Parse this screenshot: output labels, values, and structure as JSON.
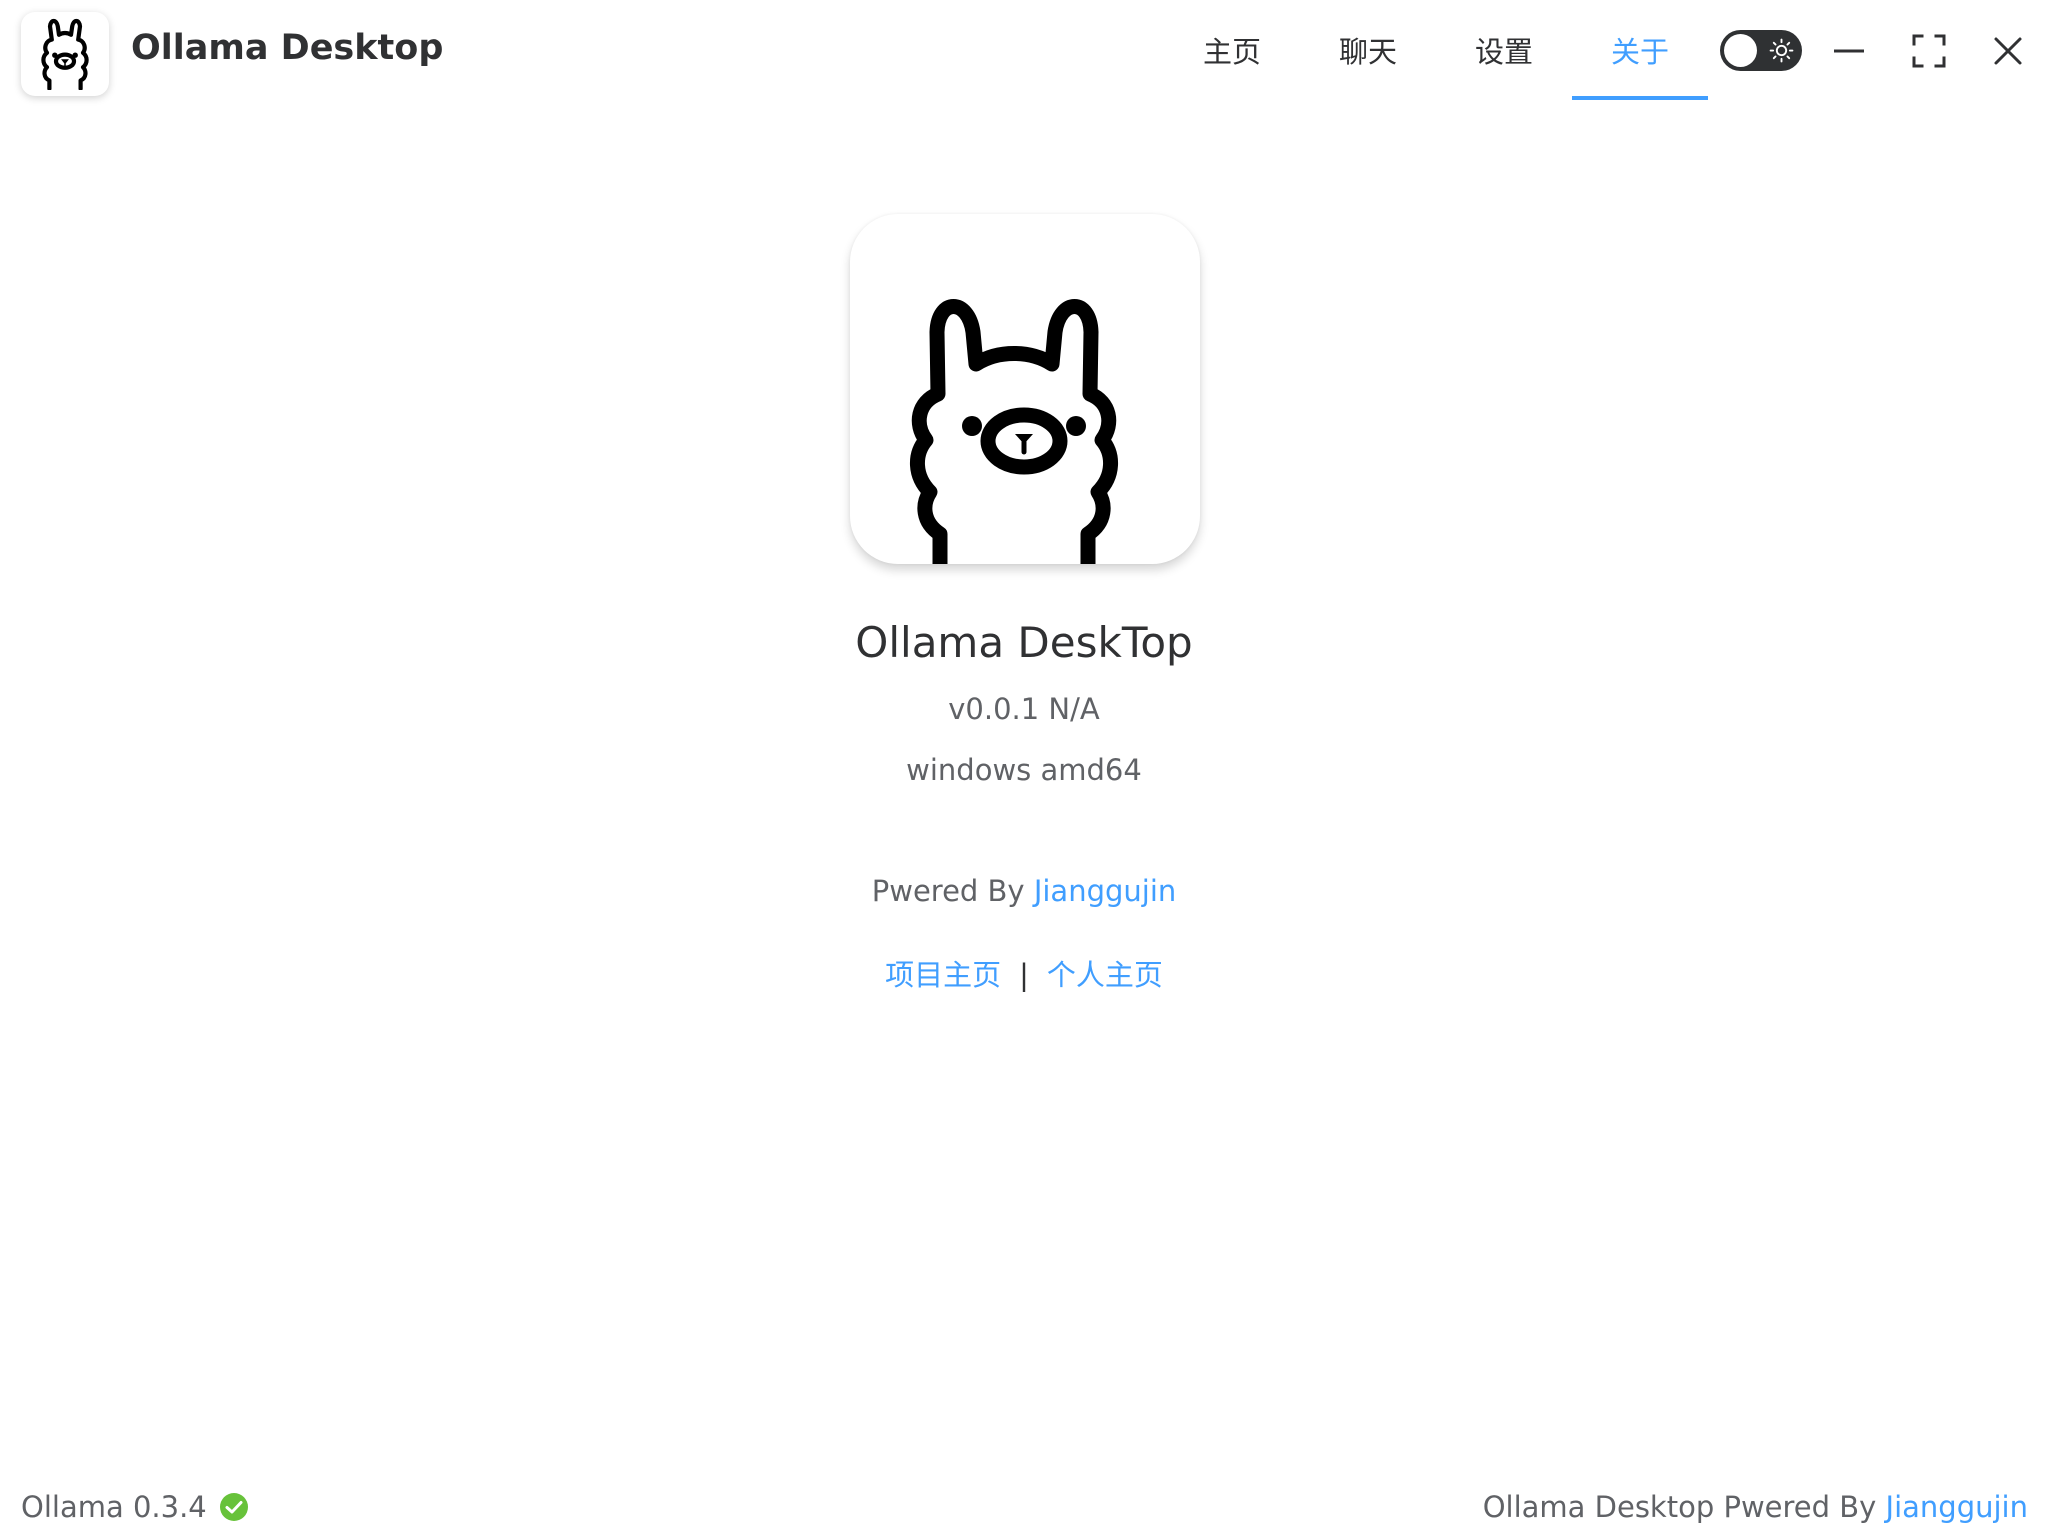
{
  "app": {
    "title": "Ollama Desktop"
  },
  "nav": {
    "tabs": [
      {
        "label": "主页",
        "active": false
      },
      {
        "label": "聊天",
        "active": false
      },
      {
        "label": "设置",
        "active": false
      },
      {
        "label": "关于",
        "active": true
      }
    ]
  },
  "theme_toggle": {
    "state": "off",
    "icon": "sun-icon"
  },
  "window_controls": {
    "icons": [
      "minimize-icon",
      "maximize-icon",
      "close-icon"
    ]
  },
  "about": {
    "logo_icon": "llama-icon",
    "name": "Ollama DeskTop",
    "version": "v0.0.1 N/A",
    "platform": "windows amd64",
    "powered_prefix": "Pwered By ",
    "powered_author": "Jianggujin",
    "links": {
      "project": "项目主页",
      "separator": "|",
      "personal": "个人主页"
    }
  },
  "footer": {
    "ollama_version": "Ollama 0.3.4",
    "status_icon": "check-circle-icon",
    "powered_prefix": "Ollama Desktop Pwered By ",
    "powered_author": "Jianggujin"
  },
  "colors": {
    "accent": "#409eff",
    "success": "#67c23a",
    "text_primary": "#303133",
    "text_secondary": "#606266"
  }
}
